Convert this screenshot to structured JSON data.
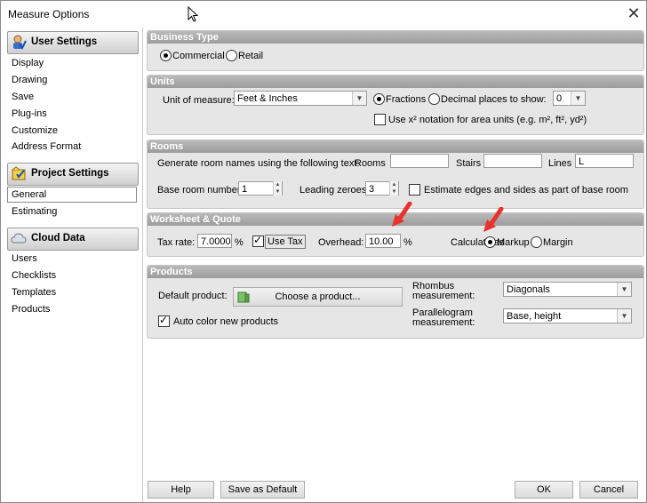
{
  "window": {
    "title": "Measure Options"
  },
  "sidebar": {
    "sections": [
      {
        "label": "User Settings",
        "items": [
          "Display",
          "Drawing",
          "Save",
          "Plug-ins",
          "Customize",
          "Address Format"
        ]
      },
      {
        "label": "Project Settings",
        "items": [
          "General",
          "Estimating"
        ],
        "selected": "General"
      },
      {
        "label": "Cloud Data",
        "items": [
          "Users",
          "Checklists",
          "Templates",
          "Products"
        ]
      }
    ]
  },
  "business_type": {
    "header": "Business Type",
    "commercial": "Commercial",
    "retail": "Retail",
    "selected": "Commercial"
  },
  "units": {
    "header": "Units",
    "unit_label": "Unit of measure:",
    "unit_value": "Feet & Inches",
    "fractions": "Fractions",
    "decimal": "Decimal places to show:",
    "selected": "Fractions",
    "decimal_value": "0",
    "x2_label": "Use x² notation for area units (e.g. m², ft², yd²)",
    "x2_checked": false
  },
  "rooms": {
    "header": "Rooms",
    "generate_label": "Generate room names using the following text:",
    "rooms_label": "Rooms",
    "rooms_value": "",
    "stairs_label": "Stairs",
    "stairs_value": "",
    "lines_label": "Lines",
    "lines_value": "L",
    "base_label": "Base room number",
    "base_value": "1",
    "zeros_label": "Leading zeroes",
    "zeros_value": "3",
    "estimate_label": "Estimate edges and sides as part of base room",
    "estimate_checked": false
  },
  "worksheet": {
    "header": "Worksheet & Quote",
    "tax_label": "Tax rate:",
    "tax_value": "7.0000",
    "pct": "%",
    "use_tax": "Use Tax",
    "use_tax_checked": true,
    "overhead_label": "Overhead:",
    "overhead_value": "10.00",
    "calc_label": "Calculate as",
    "markup": "Markup",
    "margin": "Margin",
    "selected": "Markup"
  },
  "products": {
    "header": "Products",
    "default_label": "Default product:",
    "choose_button": "Choose a product...",
    "auto_color": "Auto color new products",
    "auto_color_checked": true,
    "rhombus_label_1": "Rhombus",
    "rhombus_label_2": "measurement:",
    "rhombus_value": "Diagonals",
    "para_label_1": "Parallelogram",
    "para_label_2": "measurement:",
    "para_value": "Base, height"
  },
  "footer": {
    "help": "Help",
    "save_default": "Save as Default",
    "ok": "OK",
    "cancel": "Cancel"
  },
  "colors": {
    "panel_header": "#a9a9a9",
    "annotation_arrow": "#e8322c"
  }
}
